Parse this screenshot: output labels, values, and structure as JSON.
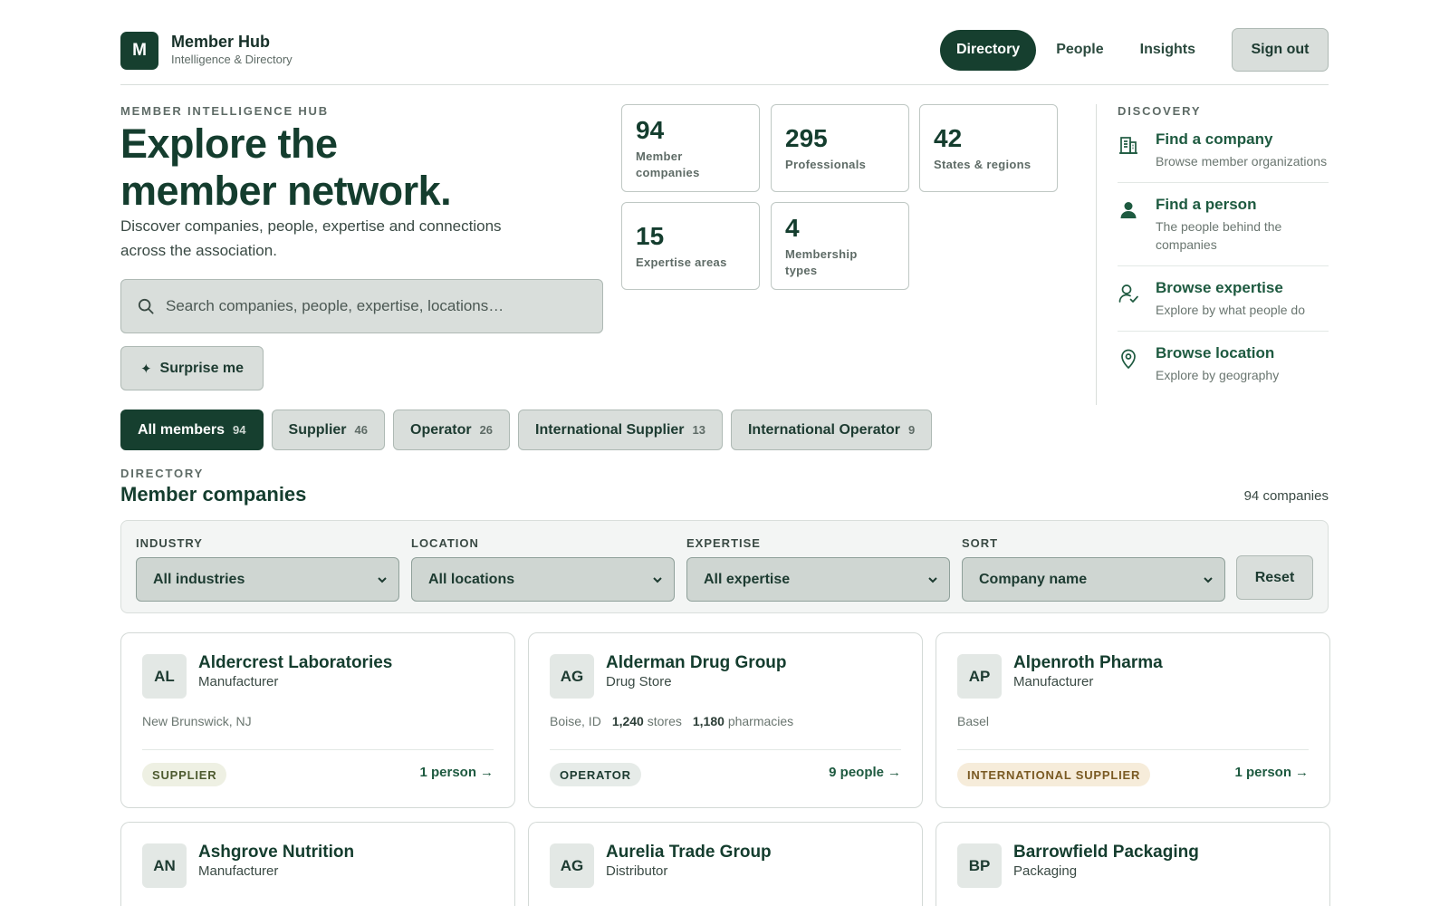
{
  "header": {
    "logo_letter": "M",
    "brand_title": "Member Hub",
    "brand_subtitle": "Intelligence & Directory",
    "nav": [
      {
        "label": "Directory",
        "active": true
      },
      {
        "label": "People",
        "active": false
      },
      {
        "label": "Insights",
        "active": false
      }
    ],
    "signout_label": "Sign out"
  },
  "hero": {
    "eyebrow": "MEMBER INTELLIGENCE HUB",
    "title_line1": "Explore the",
    "title_line2": "member network.",
    "description": "Discover companies, people, expertise and connections across the association.",
    "search_placeholder": "Search companies, people, expertise, locations…",
    "surprise_icon": "✦",
    "surprise_label": "Surprise me"
  },
  "stats": [
    {
      "value": "94",
      "label_line1": "Member",
      "label_line2": "companies"
    },
    {
      "value": "295",
      "label_line1": "Professionals",
      "label_line2": ""
    },
    {
      "value": "42",
      "label_line1": "States & regions",
      "label_line2": ""
    },
    {
      "value": "15",
      "label_line1": "Expertise areas",
      "label_line2": ""
    },
    {
      "value": "4",
      "label_line1": "Membership",
      "label_line2": "types"
    }
  ],
  "discovery": {
    "eyebrow": "DISCOVERY",
    "items": [
      {
        "icon": "building-icon",
        "title": "Find a company",
        "description": "Browse member organizations"
      },
      {
        "icon": "person-icon",
        "title": "Find a person",
        "description": "The people behind the companies"
      },
      {
        "icon": "person-check-icon",
        "title": "Browse expertise",
        "description": "Explore by what people do"
      },
      {
        "icon": "location-pin-icon",
        "title": "Browse location",
        "description": "Explore by geography"
      }
    ]
  },
  "chips": [
    {
      "label": "All members",
      "count": "94",
      "active": true
    },
    {
      "label": "Supplier",
      "count": "46",
      "active": false
    },
    {
      "label": "Operator",
      "count": "26",
      "active": false
    },
    {
      "label": "International Supplier",
      "count": "13",
      "active": false
    },
    {
      "label": "International Operator",
      "count": "9",
      "active": false
    }
  ],
  "directory": {
    "eyebrow": "DIRECTORY",
    "title": "Member companies",
    "count_text": "94 companies",
    "filters": [
      {
        "label": "INDUSTRY",
        "value": "All industries"
      },
      {
        "label": "LOCATION",
        "value": "All locations"
      },
      {
        "label": "EXPERTISE",
        "value": "All expertise"
      },
      {
        "label": "SORT",
        "value": "Company name"
      }
    ],
    "reset_label": "Reset"
  },
  "cards": [
    {
      "initials": "AL",
      "name": "Aldercrest Laboratories",
      "type": "Manufacturer",
      "location": "New Brunswick, NJ",
      "stores": "",
      "stores_label": "",
      "pharmacies": "",
      "pharmacies_label": "",
      "badge": "SUPPLIER",
      "people": "1 person",
      "arrow": "→"
    },
    {
      "initials": "AG",
      "name": "Alderman Drug Group",
      "type": "Drug Store",
      "location": "Boise, ID",
      "stores": "1,240",
      "stores_label": "stores",
      "pharmacies": "1,180",
      "pharmacies_label": "pharmacies",
      "badge": "OPERATOR",
      "people": "9 people",
      "arrow": "→"
    },
    {
      "initials": "AP",
      "name": "Alpenroth Pharma",
      "type": "Manufacturer",
      "location": "Basel",
      "stores": "",
      "stores_label": "",
      "pharmacies": "",
      "pharmacies_label": "",
      "badge": "INTERNATIONAL SUPPLIER",
      "people": "1 person",
      "arrow": "→"
    },
    {
      "initials": "AN",
      "name": "Ashgrove Nutrition",
      "type": "Manufacturer"
    },
    {
      "initials": "AG",
      "name": "Aurelia Trade Group",
      "type": "Distributor"
    },
    {
      "initials": "BP",
      "name": "Barrowfield Packaging",
      "type": "Packaging"
    }
  ]
}
